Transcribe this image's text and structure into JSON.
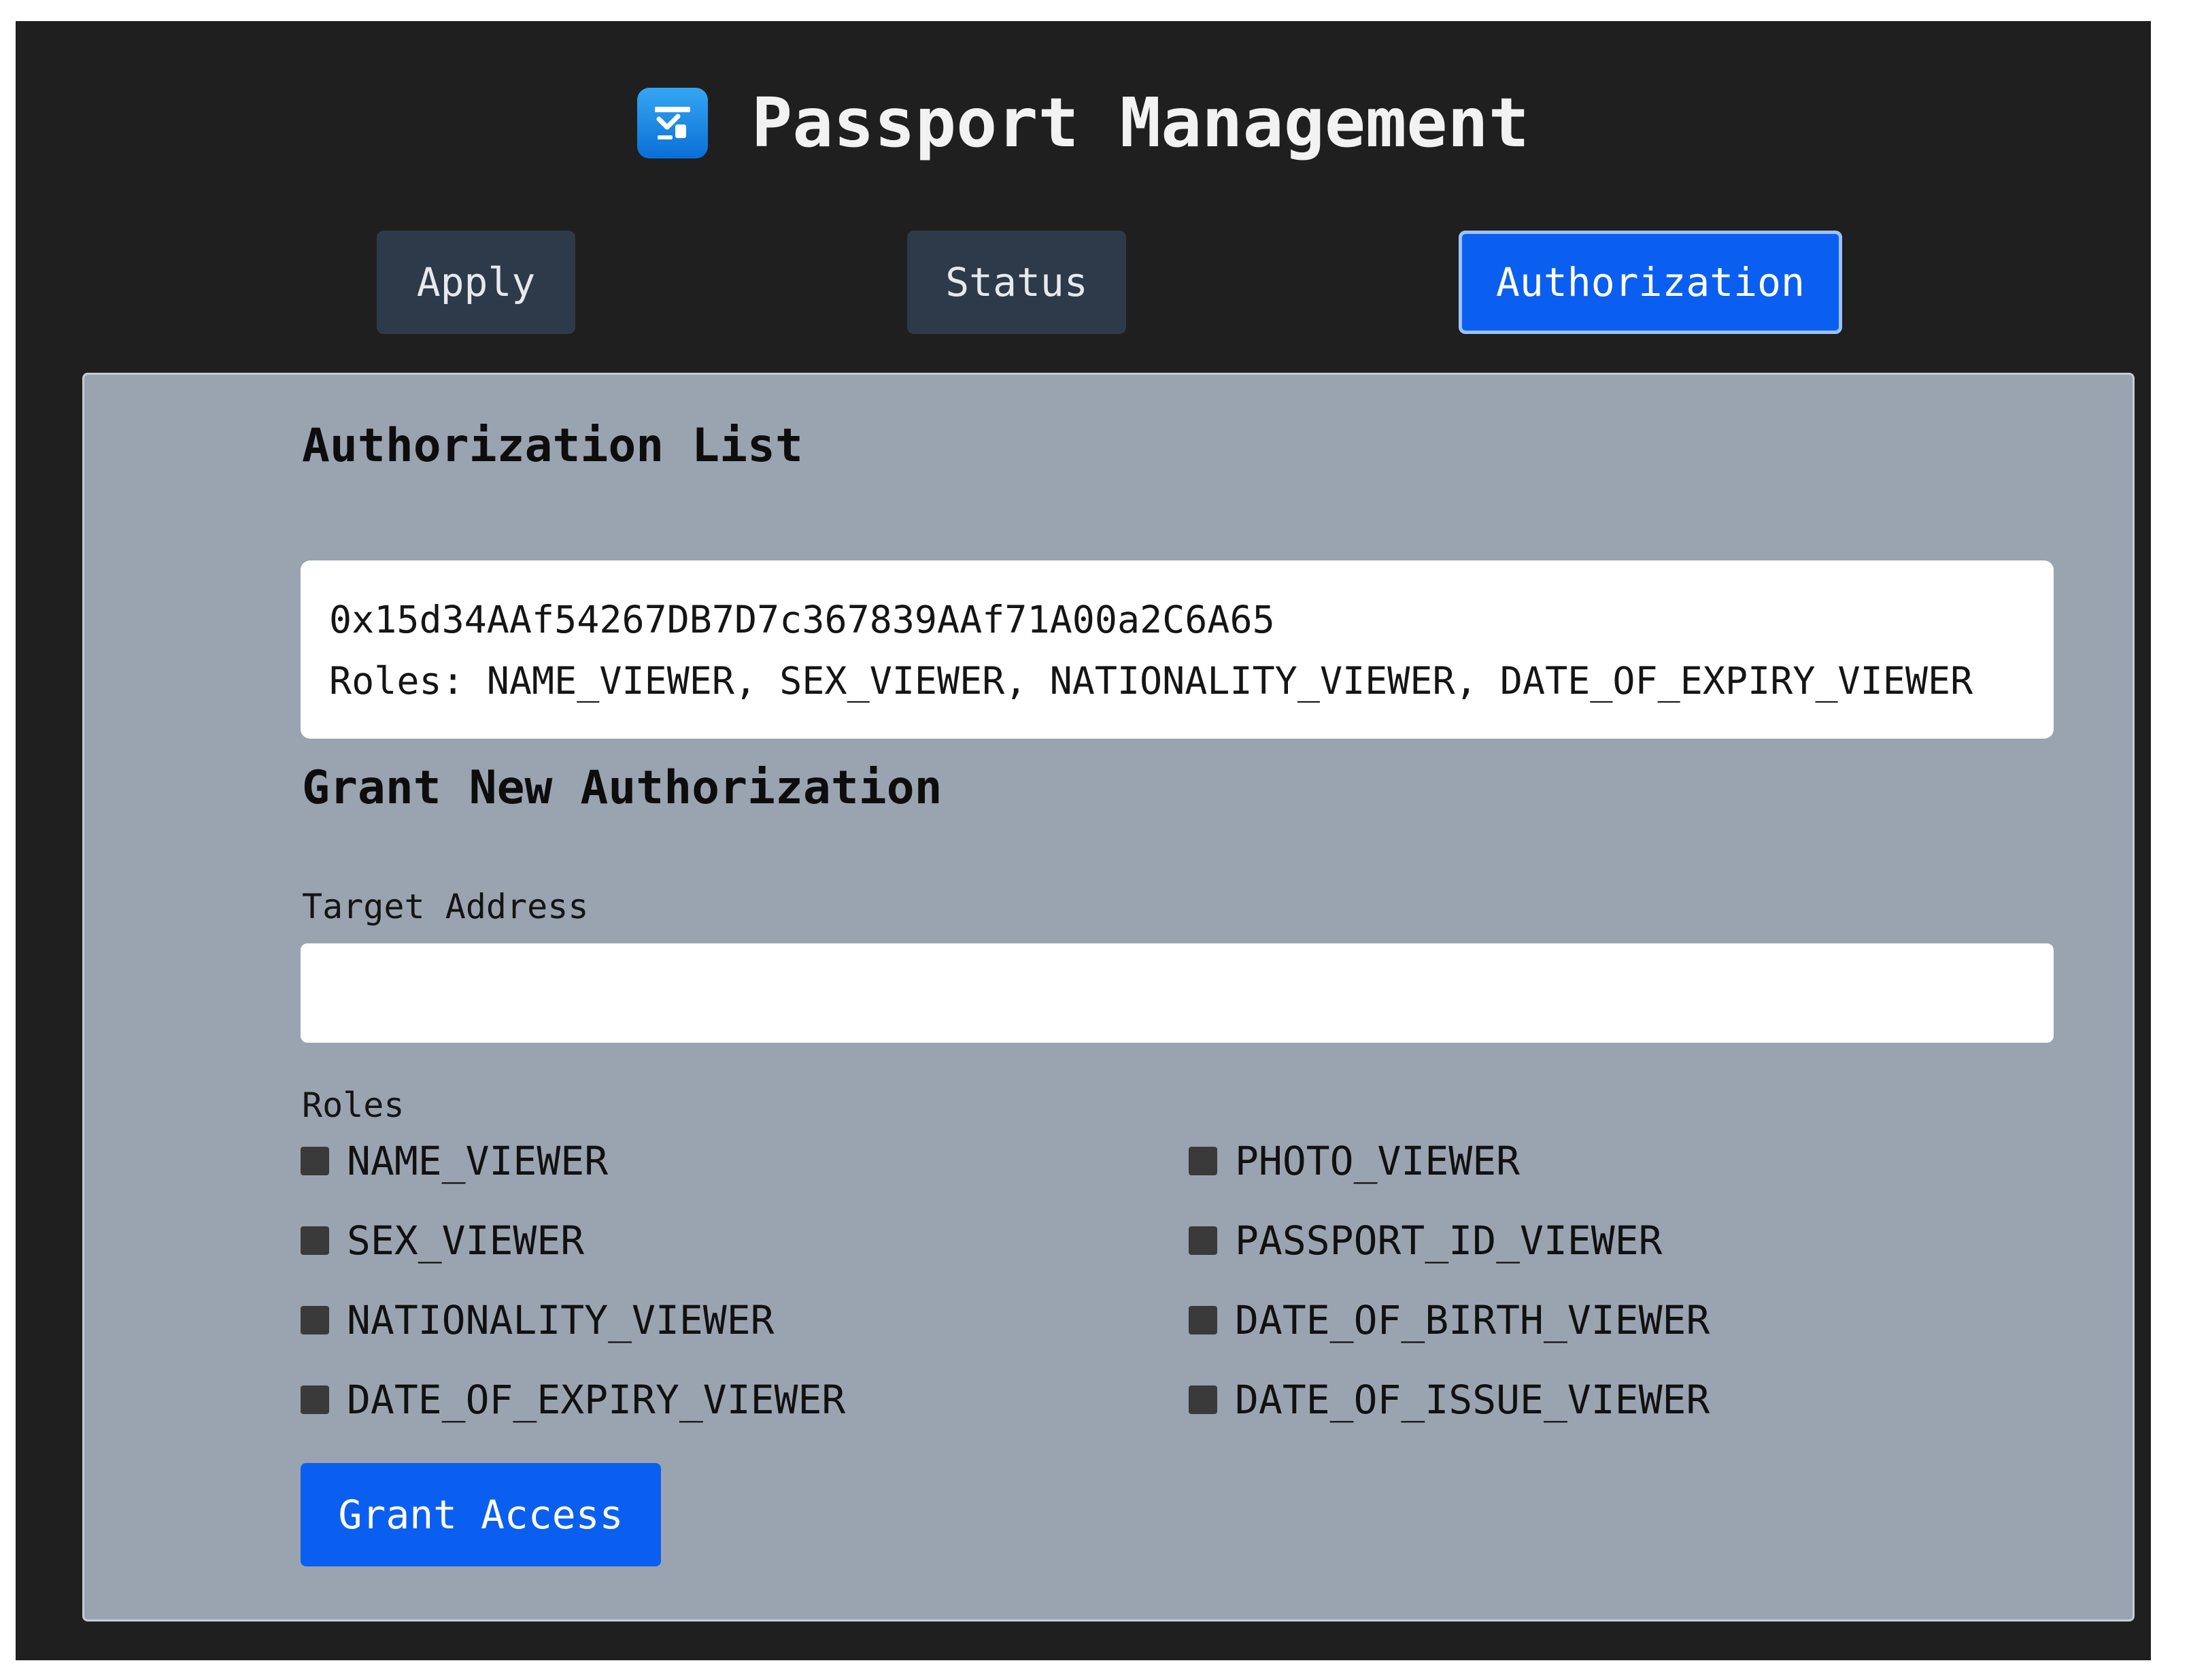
{
  "app": {
    "title": "Passport Management",
    "logo_icon": "passport-control-icon",
    "accent_color": "#0b5ff0"
  },
  "tabs": [
    {
      "label": "Apply",
      "active": false
    },
    {
      "label": "Status",
      "active": false
    },
    {
      "label": "Authorization",
      "active": true
    }
  ],
  "authorization_list": {
    "title": "Authorization List",
    "entries": [
      {
        "address": "0x15d34AAf54267DB7D7c367839AAf71A00a2C6A65",
        "roles_text": "Roles: NAME_VIEWER, SEX_VIEWER, NATIONALITY_VIEWER, DATE_OF_EXPIRY_VIEWER"
      }
    ]
  },
  "grant": {
    "title": "Grant New Authorization",
    "target_address_label": "Target Address",
    "target_address_value": "",
    "roles_label": "Roles",
    "roles": [
      "NAME_VIEWER",
      "PHOTO_VIEWER",
      "SEX_VIEWER",
      "PASSPORT_ID_VIEWER",
      "NATIONALITY_VIEWER",
      "DATE_OF_BIRTH_VIEWER",
      "DATE_OF_EXPIRY_VIEWER",
      "DATE_OF_ISSUE_VIEWER"
    ],
    "button_label": "Grant Access"
  }
}
